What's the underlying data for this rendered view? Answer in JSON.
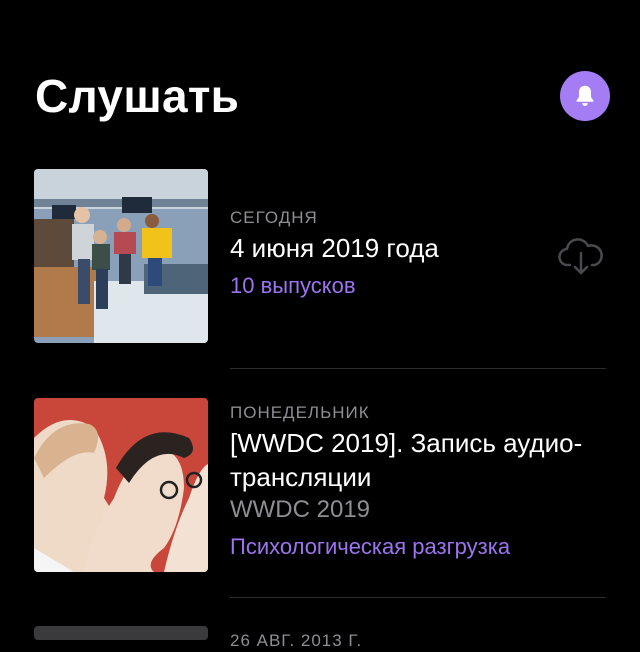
{
  "header": {
    "title": "Слушать",
    "accent_color": "#a47cf3",
    "bell_icon": "bell-icon"
  },
  "episodes": [
    {
      "caption": "СЕГОДНЯ",
      "title": "4 июня 2019 года",
      "accent": "10 выпусков",
      "action_icon": "cloud-download-icon"
    },
    {
      "caption": "ПОНЕДЕЛЬНИК",
      "title": "[WWDC 2019]. Запись аудио-трансляции",
      "subtitle": "WWDC 2019",
      "accent": "Психологическая разгрузка"
    },
    {
      "caption": "26 АВГ. 2013 Г."
    }
  ]
}
